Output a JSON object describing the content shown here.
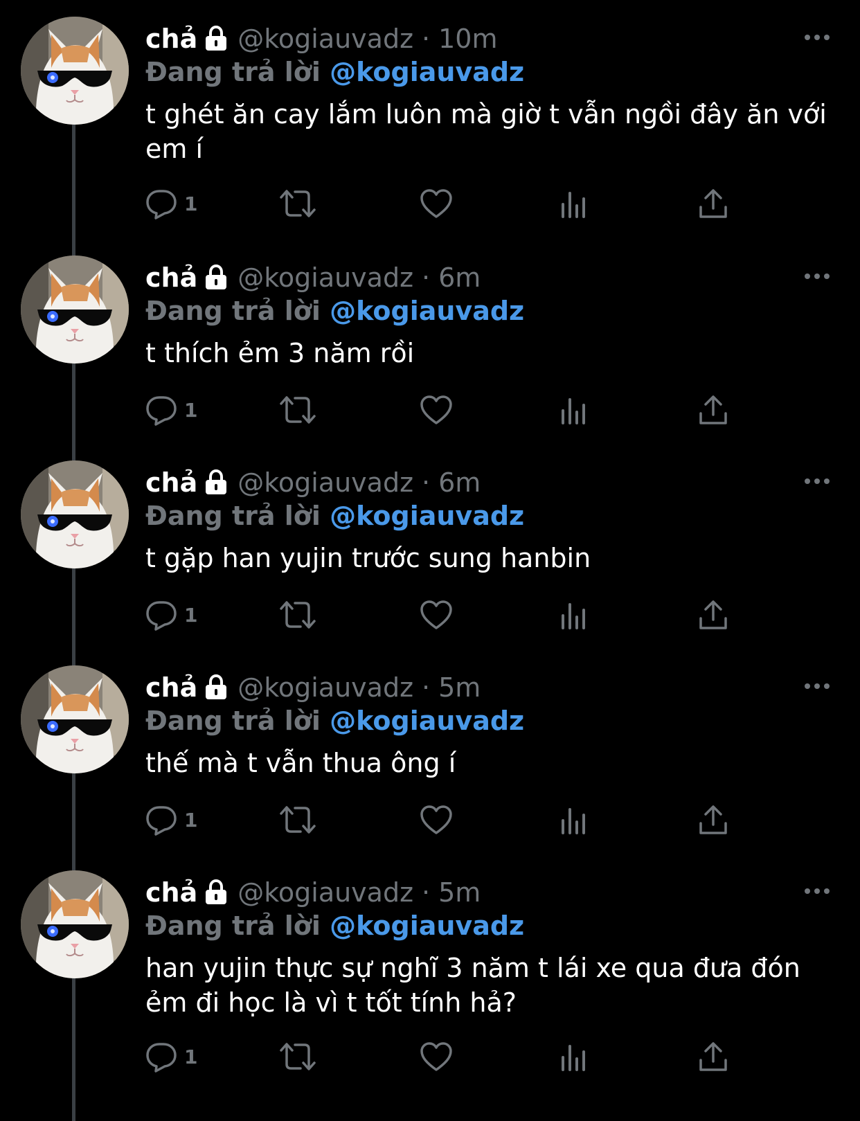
{
  "tweets": [
    {
      "name": "chả",
      "handle": "@kogiauvadz",
      "time": "10m",
      "reply_prefix": "Đang trả lời",
      "reply_to": "@kogiauvadz",
      "text": "t ghét ăn cay lắm luôn mà giờ t vẫn ngồi đây ăn với em í",
      "reply_count": "1"
    },
    {
      "name": "chả",
      "handle": "@kogiauvadz",
      "time": "6m",
      "reply_prefix": "Đang trả lời",
      "reply_to": "@kogiauvadz",
      "text": "t thích ẻm 3 năm rồi",
      "reply_count": "1"
    },
    {
      "name": "chả",
      "handle": "@kogiauvadz",
      "time": "6m",
      "reply_prefix": "Đang trả lời",
      "reply_to": "@kogiauvadz",
      "text": "t gặp han yujin trước sung hanbin",
      "reply_count": "1"
    },
    {
      "name": "chả",
      "handle": "@kogiauvadz",
      "time": "5m",
      "reply_prefix": "Đang trả lời",
      "reply_to": "@kogiauvadz",
      "text": "thế mà t vẫn thua ông í",
      "reply_count": "1"
    },
    {
      "name": "chả",
      "handle": "@kogiauvadz",
      "time": "5m",
      "reply_prefix": "Đang trả lời",
      "reply_to": "@kogiauvadz",
      "text": "han yujin thực sự nghĩ 3 năm t lái xe qua đưa đón ẻm đi học là vì t tốt tính hả?",
      "reply_count": "1"
    }
  ],
  "separator": "·",
  "icons": {
    "avatar": "cat-with-sunglasses-avatar",
    "lock": "lock-icon",
    "more": "more-icon",
    "reply": "reply-icon",
    "retweet": "retweet-icon",
    "like": "heart-icon",
    "views": "views-icon",
    "share": "share-icon"
  },
  "colors": {
    "background": "#000000",
    "mention": "#4a99e9",
    "muted": "#71767b",
    "text": "#ffffff"
  }
}
